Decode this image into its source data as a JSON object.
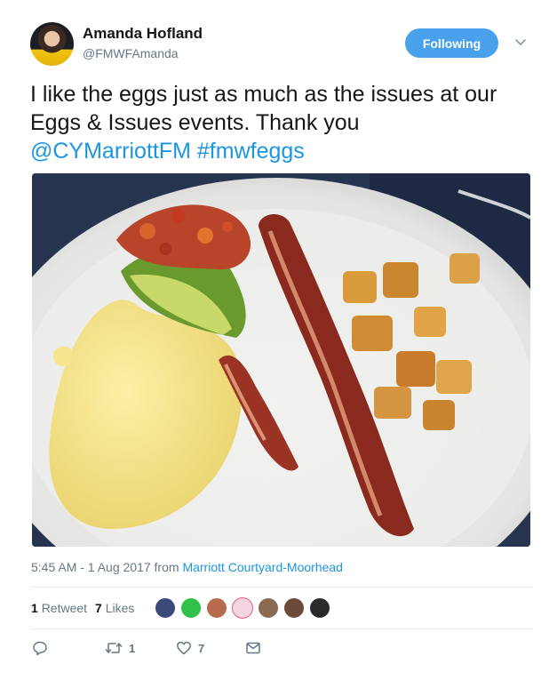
{
  "user": {
    "name": "Amanda Hofland",
    "handle": "@FMWFAmanda",
    "follow_label": "Following"
  },
  "tweet": {
    "text_plain": "I like the eggs just as much as the issues at our Eggs & Issues events. Thank you",
    "mention": "@CYMarriottFM",
    "hashtag": "#fmwfeggs"
  },
  "meta": {
    "timestamp": "5:45 AM - 1 Aug 2017",
    "from_label": "from",
    "source": "Marriott Courtyard-Moorhead"
  },
  "stats": {
    "retweets_count": "1",
    "retweets_label": "Retweet",
    "likes_count": "7",
    "likes_label": "Likes"
  },
  "actions": {
    "reply_count": "",
    "retweet_count": "1",
    "like_count": "7"
  },
  "likers": [
    {
      "color": "#3b4a78"
    },
    {
      "color": "#2fc24a"
    },
    {
      "color": "#b86a4e"
    },
    {
      "color": "#e85a8a"
    },
    {
      "color": "#8a6a52"
    },
    {
      "color": "#6b4a3a"
    },
    {
      "color": "#2a2a2a"
    }
  ],
  "colors": {
    "accent": "#1b95e0",
    "follow_button": "#4aa1eb",
    "muted": "#657786"
  },
  "icons": [
    "chevron-down-icon",
    "reply-icon",
    "retweet-icon",
    "heart-icon",
    "message-icon"
  ]
}
